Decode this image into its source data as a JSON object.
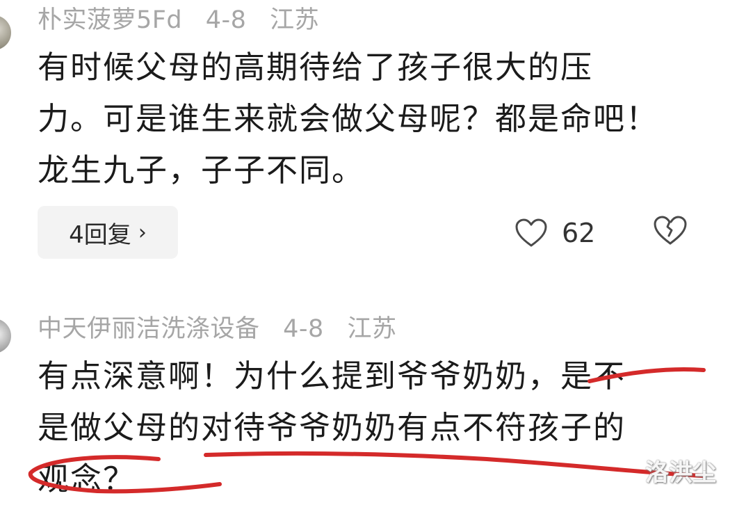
{
  "comments": [
    {
      "username": "朴实菠萝5Fd",
      "date": "4-8",
      "location": "江苏",
      "lines": [
        "有时候父母的高期待给了孩子很大的压",
        "力。可是谁生来就会做父母呢？都是命吧！",
        "龙生九子，子子不同。"
      ],
      "reply_label": "4回复",
      "reply_chevron": "›",
      "likes": "62"
    },
    {
      "username": "中天伊丽洁洗涤设备",
      "date": "4-8",
      "location": "江苏",
      "lines": [
        "有点深意啊！为什么提到爷爷奶奶，是不",
        "是做父母的对待爷爷奶奶有点不符孩子的",
        "观念？"
      ]
    }
  ],
  "icons": {
    "like": "heart-outline-icon",
    "dislike": "broken-heart-icon"
  },
  "colors": {
    "annotation": "#d42a2a",
    "meta": "#a6a6a6",
    "text": "#1b1b1b"
  },
  "watermark": "洛洪尘"
}
